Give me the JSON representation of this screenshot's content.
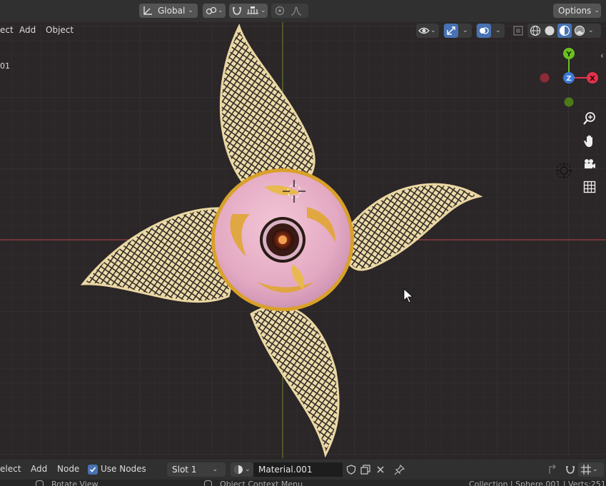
{
  "header": {
    "transform_orientation": "Global",
    "options_label": "Options"
  },
  "viewport_menu": {
    "select_label": "ect",
    "add_label": "Add",
    "object_label": "Object",
    "info_text": "01"
  },
  "gizmo": {
    "x_label": "X",
    "y_label": "Y",
    "z_label": "Z"
  },
  "node_header": {
    "select_label": "elect",
    "add_label": "Add",
    "node_label": "Node",
    "use_nodes_label": "Use Nodes",
    "use_nodes_checked": true,
    "slot_label": "Slot 1",
    "material_name": "Material.001"
  },
  "status_bar": {
    "left_text": "Rotate View",
    "middle_text": "Object Context Menu",
    "right_text": "Collection | Sphere.001 | Verts:251"
  },
  "colors": {
    "accent_blue": "#4772b3",
    "axis_x": "#e2334a",
    "axis_y": "#6bbf22",
    "axis_z": "#3c7ad6",
    "petal": "#ecdcaa",
    "sphere": "#e9b0c8",
    "gold": "#d9a02a"
  }
}
